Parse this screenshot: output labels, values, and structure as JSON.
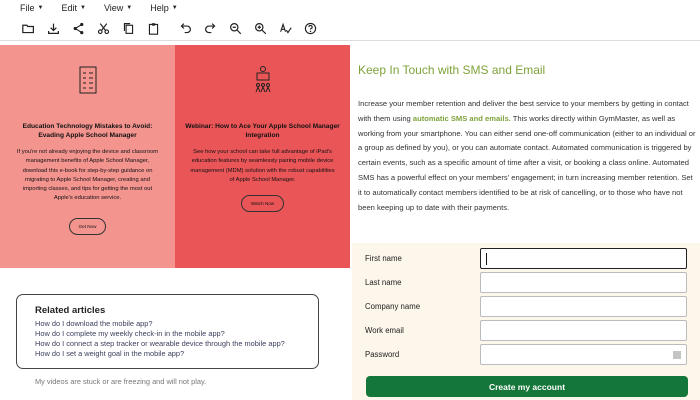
{
  "menubar": {
    "items": [
      "File",
      "Edit",
      "View",
      "Help"
    ]
  },
  "toolbar": {
    "icons": [
      "folder-open-icon",
      "download-icon",
      "share-icon",
      "cut-icon",
      "copy-icon",
      "paste-icon",
      "undo-icon",
      "redo-icon",
      "zoom-out-icon",
      "zoom-in-icon",
      "spellcheck-icon",
      "help-icon"
    ]
  },
  "card1": {
    "title": "Education Technology Mistakes to Avoid: Evading Apple School Manager",
    "body": "If you're not already enjoying the device and classroom management benefits of Apple School Manager, download this e-book for step-by-step guidance on migrating to Apple School Manager, creating and importing classes, and tips for getting the most out Apple's education service.",
    "button": "Get Now"
  },
  "card2": {
    "title": "Webinar: How to Ace Your Apple School Manager Integration",
    "body": "See how your school can take full advantage of iPad's education features by seamlessly pairing mobile device management (MDM) solution with the robust capabilities of Apple School Manager.",
    "button": "Watch Now"
  },
  "related": {
    "title": "Related articles",
    "links": [
      "How do I download the mobile app?",
      "How do I complete my weekly check-in in the mobile app?",
      "How do I connect a step tracker or wearable device through the mobile app?",
      "How do I set a weight goal in the mobile app?"
    ],
    "overflow": "My videos are stuck or are freezing and will not play."
  },
  "sms": {
    "title": "Keep In Touch with SMS and Email",
    "body_pre": "Increase your member retention and deliver the best service to your members by getting in contact with them using ",
    "body_highlight": "automatic SMS and emails.",
    "body_post": " This works directly within GymMaster, as well as working from your smartphone. You can either send one-off communication (either to an individual or a group as defined by you), or you can automate contact. Automated communication is triggered by certain events, such as a specific amount of time after a visit, or booking a class online. Automated SMS has a powerful effect on your members' engagement; in turn increasing member retention. Set it to automatically contact members identified to be at risk of cancelling, or to those who have not been keeping up to date with their payments."
  },
  "form": {
    "fields": [
      {
        "label": "First name",
        "value": ""
      },
      {
        "label": "Last name",
        "value": ""
      },
      {
        "label": "Company name",
        "value": ""
      },
      {
        "label": "Work email",
        "value": ""
      },
      {
        "label": "Password",
        "value": ""
      }
    ],
    "submit": "Create my account"
  },
  "colors": {
    "card1": "#f4948f",
    "card2": "#ea5558",
    "accent_green": "#7ea23a",
    "button_green": "#15763a",
    "form_bg": "#fdf6ea"
  }
}
